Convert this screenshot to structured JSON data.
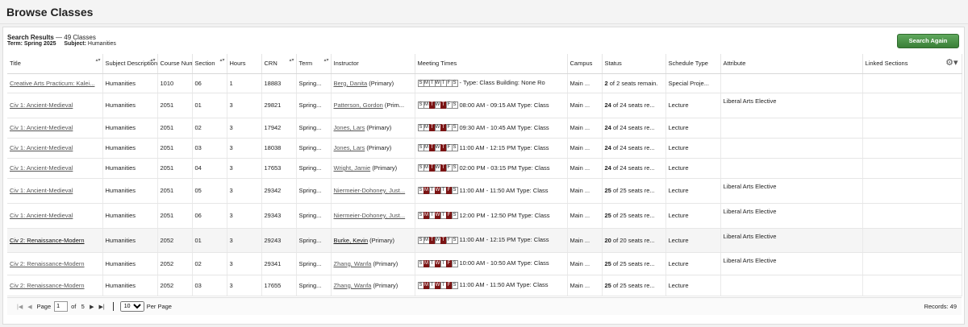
{
  "page": {
    "title": "Browse Classes"
  },
  "results": {
    "label": "Search Results",
    "count_text": "— 49 Classes",
    "term_label": "Term:",
    "term_value": "Spring 2025",
    "subject_label": "Subject:",
    "subject_value": "Humanities",
    "search_again_label": "Search Again"
  },
  "columns": [
    "Title",
    "Subject Description",
    "Course Number",
    "Section",
    "Hours",
    "CRN",
    "Term",
    "Instructor",
    "Meeting Times",
    "Campus",
    "Status",
    "Schedule Type",
    "Attribute",
    "Linked Sections"
  ],
  "day_letters": [
    "S",
    "M",
    "T",
    "W",
    "T",
    "F",
    "S"
  ],
  "rows": [
    {
      "title": "Creative Arts Practicum: Kalei...",
      "subject": "Humanities",
      "course": "1010",
      "section": "06",
      "hours": "1",
      "crn": "18883",
      "term": "Spring...",
      "instructor": "Berg, Danita",
      "instr_role": "(Primary)",
      "days": [
        0,
        0,
        0,
        0,
        0,
        0,
        0
      ],
      "time": "- Type: Class  Building: None  Ro",
      "campus": "Main ...",
      "status_num": "2",
      "status_rest": "of 2 seats remain.",
      "schedule": "Special Proje...",
      "attribute": "",
      "highlight": false
    },
    {
      "title": "Civ 1: Ancient-Medieval",
      "subject": "Humanities",
      "course": "2051",
      "section": "01",
      "hours": "3",
      "crn": "29821",
      "term": "Spring...",
      "instructor": "Patterson, Gordon",
      "instr_role": "(Prim...",
      "days": [
        0,
        0,
        1,
        0,
        1,
        0,
        0
      ],
      "time": "08:00 AM - 09:15 AM Type: Class",
      "campus": "Main ...",
      "status_num": "24",
      "status_rest": "of 24 seats re...",
      "schedule": "Lecture",
      "attribute": "Liberal Arts Elective",
      "highlight": false
    },
    {
      "title": "Civ 1: Ancient-Medieval",
      "subject": "Humanities",
      "course": "2051",
      "section": "02",
      "hours": "3",
      "crn": "17942",
      "term": "Spring...",
      "instructor": "Jones, Lars",
      "instr_role": "(Primary)",
      "days": [
        0,
        0,
        1,
        0,
        1,
        0,
        0
      ],
      "time": "09:30 AM - 10:45 AM Type: Class",
      "campus": "Main ...",
      "status_num": "24",
      "status_rest": "of 24 seats re...",
      "schedule": "Lecture",
      "attribute": "",
      "highlight": false
    },
    {
      "title": "Civ 1: Ancient-Medieval",
      "subject": "Humanities",
      "course": "2051",
      "section": "03",
      "hours": "3",
      "crn": "18038",
      "term": "Spring...",
      "instructor": "Jones, Lars",
      "instr_role": "(Primary)",
      "days": [
        0,
        0,
        1,
        0,
        1,
        0,
        0
      ],
      "time": "11:00 AM - 12:15 PM Type: Class",
      "campus": "Main ...",
      "status_num": "24",
      "status_rest": "of 24 seats re...",
      "schedule": "Lecture",
      "attribute": "",
      "highlight": false
    },
    {
      "title": "Civ 1: Ancient-Medieval",
      "subject": "Humanities",
      "course": "2051",
      "section": "04",
      "hours": "3",
      "crn": "17653",
      "term": "Spring...",
      "instructor": "Wright, Jamie",
      "instr_role": "(Primary)",
      "days": [
        0,
        0,
        1,
        0,
        1,
        0,
        0
      ],
      "time": "02:00 PM - 03:15 PM Type: Class",
      "campus": "Main ...",
      "status_num": "24",
      "status_rest": "of 24 seats re...",
      "schedule": "Lecture",
      "attribute": "",
      "highlight": false
    },
    {
      "title": "Civ 1: Ancient-Medieval",
      "subject": "Humanities",
      "course": "2051",
      "section": "05",
      "hours": "3",
      "crn": "29342",
      "term": "Spring...",
      "instructor": "Niermeier-Dohoney, Just...",
      "instr_role": "",
      "days": [
        0,
        1,
        0,
        1,
        0,
        1,
        0
      ],
      "time": "11:00 AM - 11:50 AM Type: Class",
      "campus": "Main ...",
      "status_num": "25",
      "status_rest": "of 25 seats re...",
      "schedule": "Lecture",
      "attribute": "Liberal Arts Elective",
      "highlight": false
    },
    {
      "title": "Civ 1: Ancient-Medieval",
      "subject": "Humanities",
      "course": "2051",
      "section": "06",
      "hours": "3",
      "crn": "29343",
      "term": "Spring...",
      "instructor": "Niermeier-Dohoney, Just...",
      "instr_role": "",
      "days": [
        0,
        1,
        0,
        1,
        0,
        1,
        0
      ],
      "time": "12:00 PM - 12:50 PM Type: Class",
      "campus": "Main ...",
      "status_num": "25",
      "status_rest": "of 25 seats re...",
      "schedule": "Lecture",
      "attribute": "Liberal Arts Elective",
      "highlight": false
    },
    {
      "title": "Civ 2: Renaissance-Modern",
      "subject": "Humanities",
      "course": "2052",
      "section": "01",
      "hours": "3",
      "crn": "29243",
      "term": "Spring...",
      "instructor": "Burke, Kevin",
      "instr_role": "(Primary)",
      "days": [
        0,
        0,
        1,
        0,
        1,
        0,
        0
      ],
      "time": "11:00 AM - 12:15 PM Type: Class",
      "campus": "Main ...",
      "status_num": "20",
      "status_rest": "of 20 seats re...",
      "schedule": "Lecture",
      "attribute": "Liberal Arts Elective",
      "highlight": true
    },
    {
      "title": "Civ 2: Renaissance-Modern",
      "subject": "Humanities",
      "course": "2052",
      "section": "02",
      "hours": "3",
      "crn": "29341",
      "term": "Spring...",
      "instructor": "Zhang, Wanfa",
      "instr_role": "(Primary)",
      "days": [
        0,
        1,
        0,
        1,
        0,
        1,
        0
      ],
      "time": "10:00 AM - 10:50 AM Type: Class",
      "campus": "Main ...",
      "status_num": "25",
      "status_rest": "of 25 seats re...",
      "schedule": "Lecture",
      "attribute": "Liberal Arts Elective",
      "highlight": false
    },
    {
      "title": "Civ 2: Renaissance-Modern",
      "subject": "Humanities",
      "course": "2052",
      "section": "03",
      "hours": "3",
      "crn": "17655",
      "term": "Spring...",
      "instructor": "Zhang, Wanfa",
      "instr_role": "(Primary)",
      "days": [
        0,
        1,
        0,
        1,
        0,
        1,
        0
      ],
      "time": "11:00 AM - 11:50 AM Type: Class",
      "campus": "Main ...",
      "status_num": "25",
      "status_rest": "of 25 seats re...",
      "schedule": "Lecture",
      "attribute": "",
      "highlight": false
    }
  ],
  "pager": {
    "page_label": "Page",
    "page_value": "1",
    "of_label": "of",
    "total_pages": "5",
    "per_page_value": "10",
    "per_page_label": "Per Page",
    "records_text": "Records: 49"
  },
  "icons": {
    "settings": "gear-icon",
    "first": "first-page-icon",
    "prev": "prev-page-icon",
    "next": "next-page-icon",
    "last": "last-page-icon",
    "sort": "sort-icon"
  },
  "colors": {
    "day_active": "#7b1414",
    "search_again": "#4a9247"
  }
}
